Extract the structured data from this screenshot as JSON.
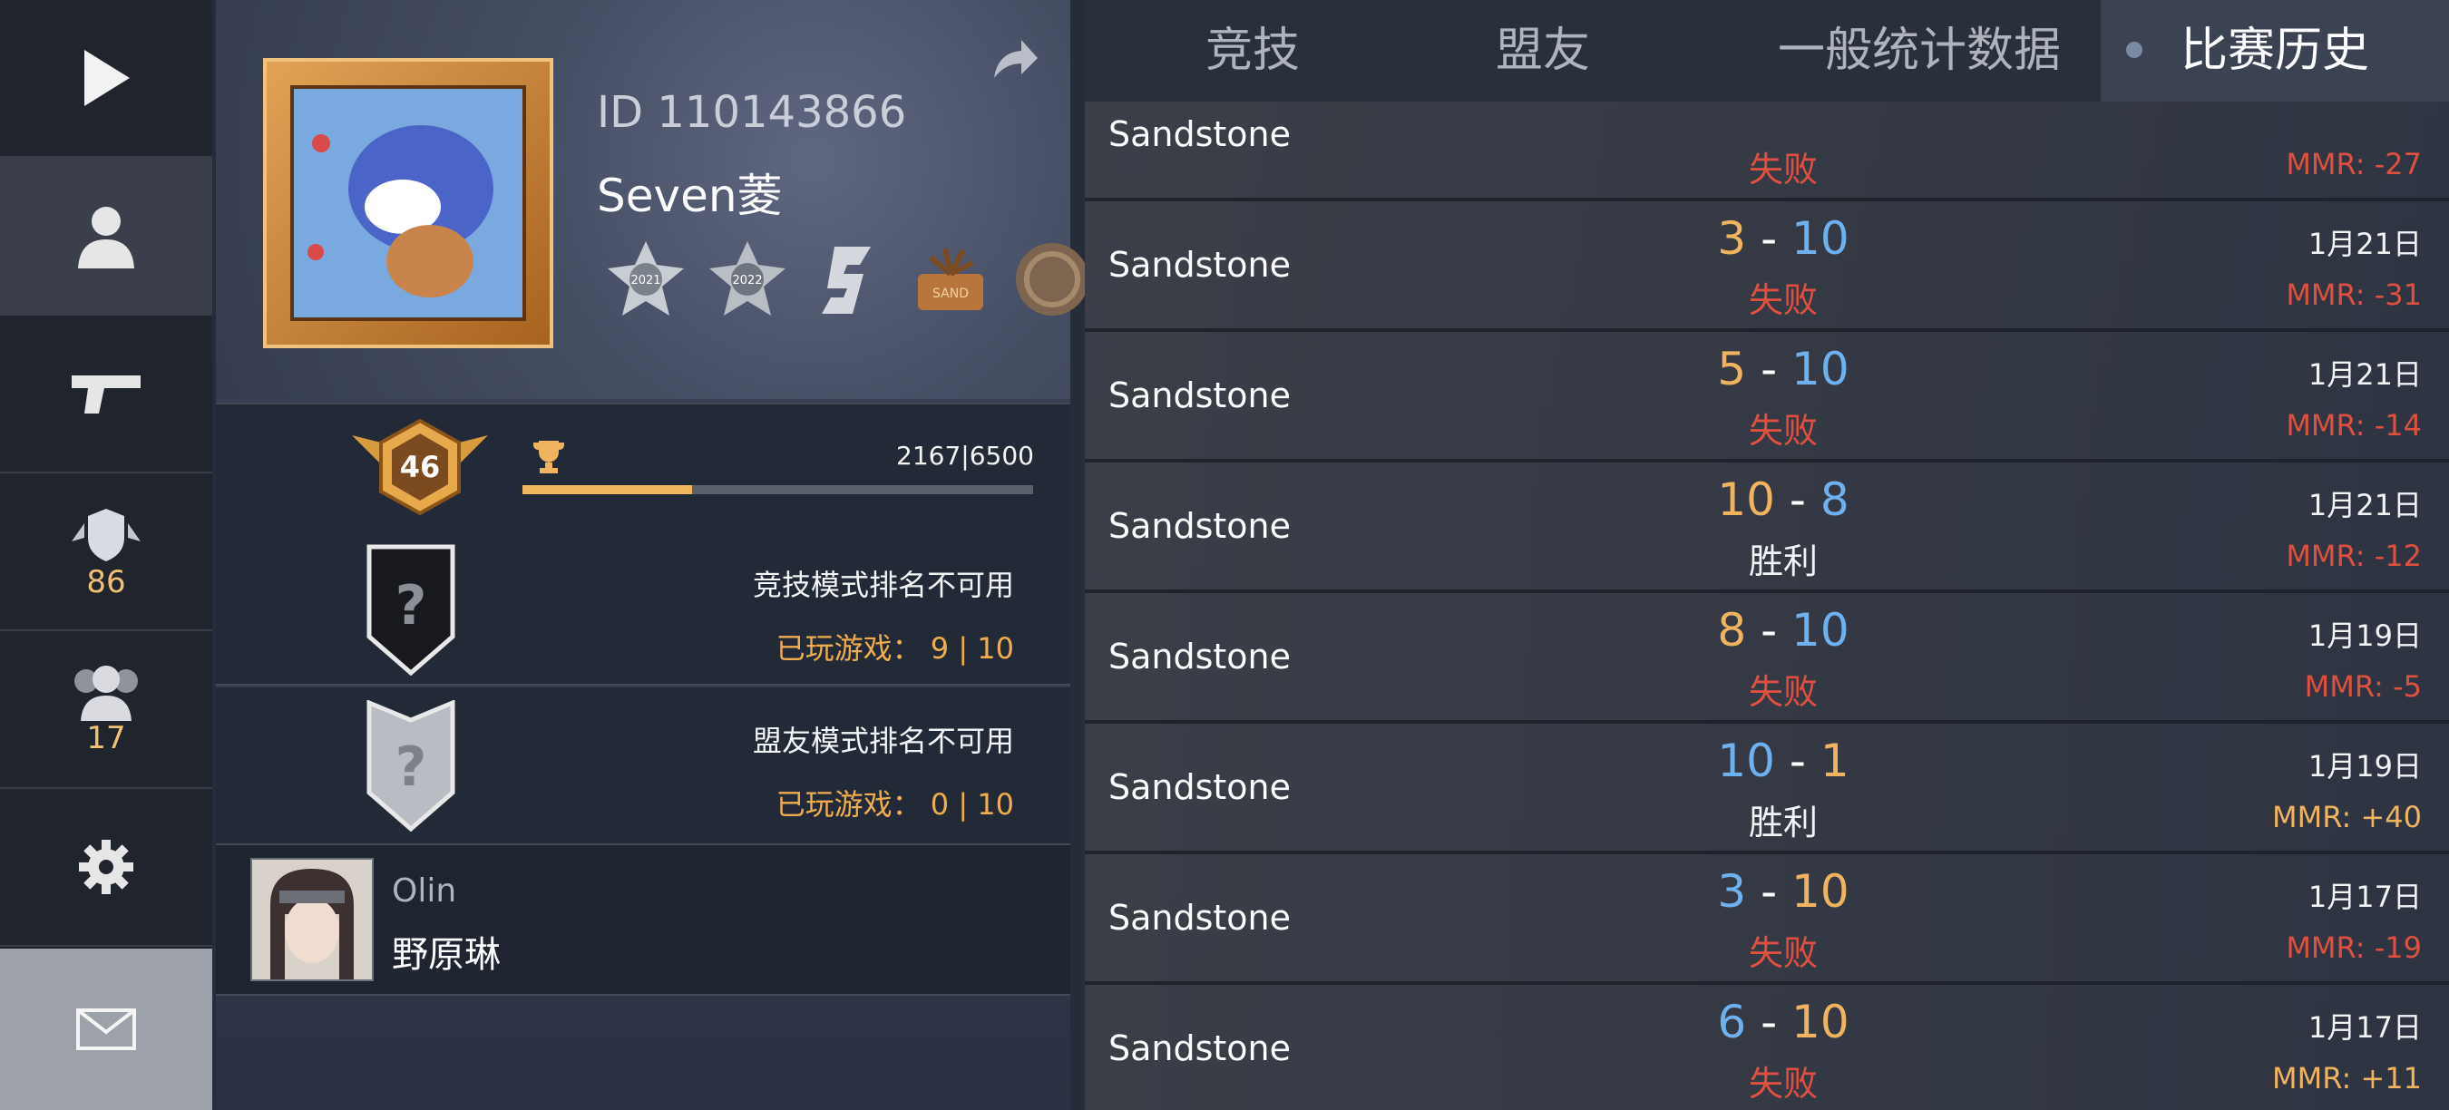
{
  "nav": {
    "items": [
      {
        "icon": "play-icon"
      },
      {
        "icon": "person-icon"
      },
      {
        "icon": "pistol-icon"
      },
      {
        "icon": "shield-wings-icon",
        "count": "86"
      },
      {
        "icon": "friends-icon",
        "count": "17"
      },
      {
        "icon": "gear-icon"
      },
      {
        "icon": "mail-icon"
      }
    ]
  },
  "profile": {
    "id": "ID 110143866",
    "name": "Seven菱",
    "level": "46",
    "xp": "2167|6500",
    "xp_progress": 0.333,
    "badges": [
      {
        "icon": "season-2021-badge-icon",
        "text": "2021"
      },
      {
        "icon": "season-2022-badge-icon",
        "text": "2022"
      },
      {
        "icon": "s-badge-icon"
      },
      {
        "icon": "palm-badge-icon",
        "text": "SAND"
      },
      {
        "icon": "coin-badge-icon"
      }
    ]
  },
  "ranks": [
    {
      "title": "竞技模式排名不可用",
      "played": "已玩游戏： 9 | 10"
    },
    {
      "title": "盟友模式排名不可用",
      "played": "已玩游戏： 0 | 10"
    }
  ],
  "friend": {
    "nick": "Olin",
    "name": "野原琳"
  },
  "tabs": [
    {
      "label": "竞技"
    },
    {
      "label": "盟友"
    },
    {
      "label": "一般统计数据"
    },
    {
      "label": "比赛历史"
    }
  ],
  "colors": {
    "orange": "#f0b35f",
    "blue": "#6fb0ef",
    "red": "#e0503f"
  },
  "matches": [
    {
      "map": "Sandstone",
      "result": "失败",
      "mmr": "MMR: -27"
    },
    {
      "map": "Sandstone",
      "score_a": "3",
      "score_b": "10",
      "result": "失败",
      "date": "1月21日",
      "mmr": "MMR: -31"
    },
    {
      "map": "Sandstone",
      "score_a": "5",
      "score_b": "10",
      "result": "失败",
      "date": "1月21日",
      "mmr": "MMR: -14"
    },
    {
      "map": "Sandstone",
      "score_a": "10",
      "score_b": "8",
      "result": "胜利",
      "date": "1月21日",
      "mmr": "MMR: -12"
    },
    {
      "map": "Sandstone",
      "score_a": "8",
      "score_b": "10",
      "result": "失败",
      "date": "1月19日",
      "mmr": "MMR: -5"
    },
    {
      "map": "Sandstone",
      "score_a": "10",
      "score_b": "1",
      "result": "胜利",
      "date": "1月19日",
      "mmr": "MMR: +40"
    },
    {
      "map": "Sandstone",
      "score_a": "3",
      "score_b": "10",
      "result": "失败",
      "date": "1月17日",
      "mmr": "MMR: -19"
    },
    {
      "map": "Sandstone",
      "score_a": "6",
      "score_b": "10",
      "result": "失败",
      "date": "1月17日",
      "mmr": "MMR: +11"
    }
  ]
}
